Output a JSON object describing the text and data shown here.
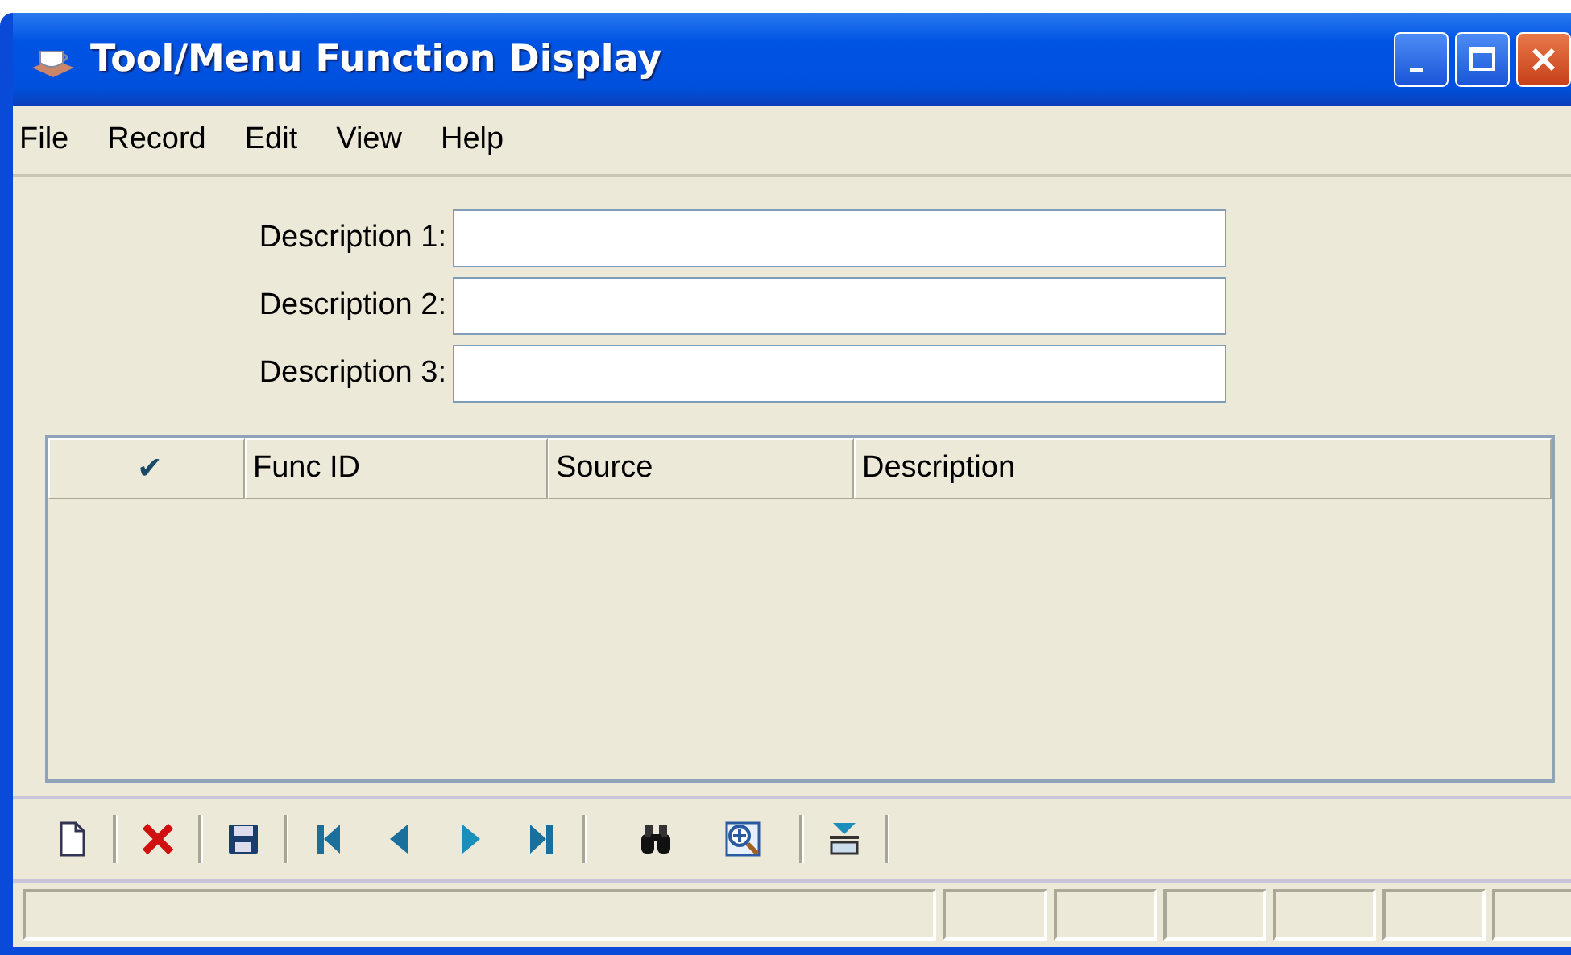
{
  "window": {
    "title": "Tool/Menu Function Display"
  },
  "menu": [
    "File",
    "Record",
    "Edit",
    "View",
    "Help"
  ],
  "fields": [
    {
      "label": "Description 1:"
    },
    {
      "label": "Description 2:"
    },
    {
      "label": "Description 3:"
    }
  ],
  "table": {
    "columns": [
      "✔",
      "Func ID",
      "Source",
      "Description"
    ]
  }
}
